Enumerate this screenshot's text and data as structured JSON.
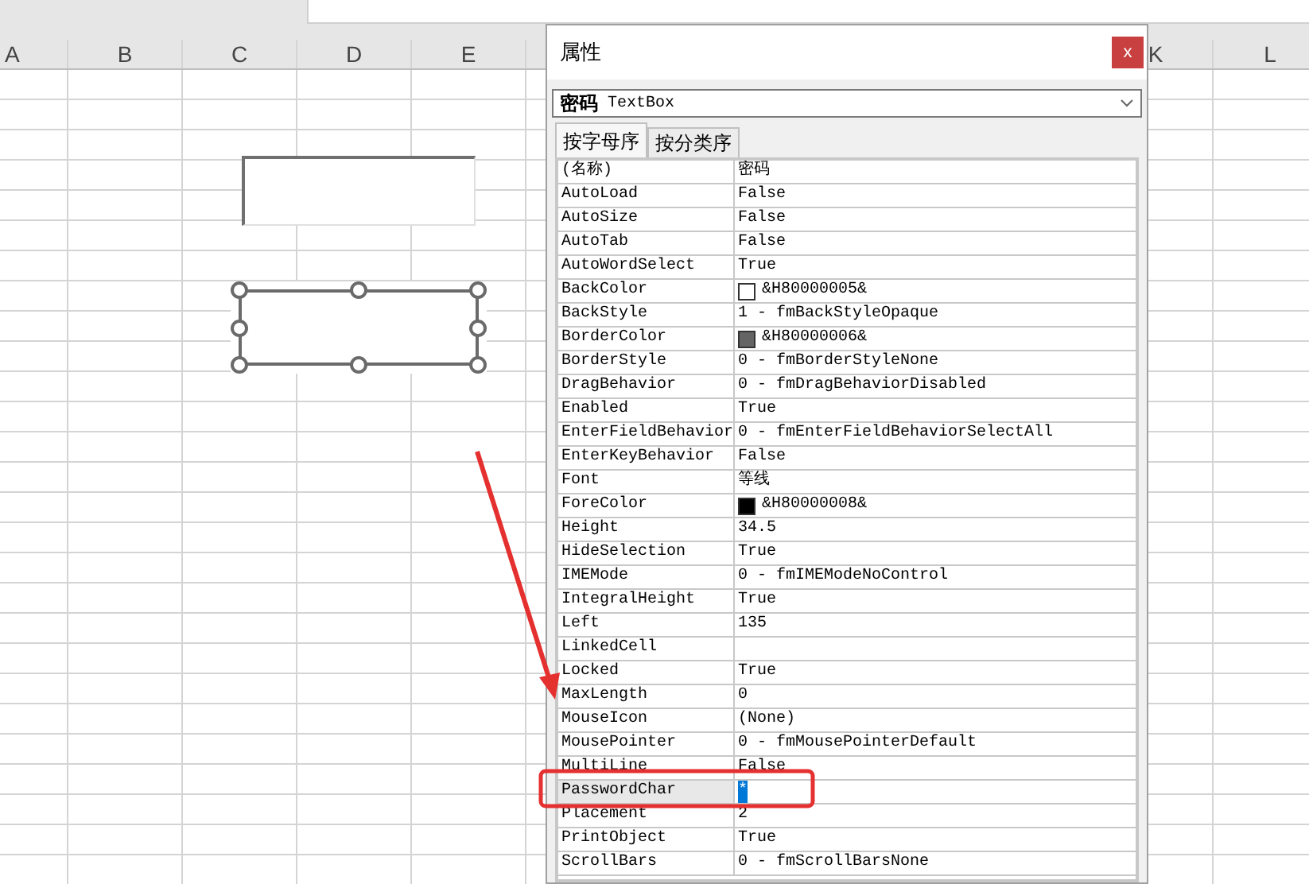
{
  "sheet": {
    "columns": [
      {
        "label": "A"
      },
      {
        "label": "B"
      },
      {
        "label": "C"
      },
      {
        "label": "D"
      },
      {
        "label": "E"
      }
    ],
    "right_columns": [
      {
        "label": "K"
      },
      {
        "label": "L"
      }
    ]
  },
  "properties_window": {
    "title": "属性",
    "close": "x",
    "object_selector": {
      "name": "密码",
      "type": "TextBox"
    },
    "tabs": [
      {
        "label": "按字母序",
        "selected": true
      },
      {
        "label": "按分类序",
        "selected": false
      }
    ],
    "rows": [
      {
        "name": "(名称)",
        "value": "密码",
        "selected": false
      },
      {
        "name": "AutoLoad",
        "value": "False",
        "selected": false
      },
      {
        "name": "AutoSize",
        "value": "False",
        "selected": false
      },
      {
        "name": "AutoTab",
        "value": "False",
        "selected": false
      },
      {
        "name": "AutoWordSelect",
        "value": "True",
        "selected": false
      },
      {
        "name": "BackColor",
        "value": "&H80000005&",
        "kind": "color",
        "color": "#ffffff",
        "selected": false
      },
      {
        "name": "BackStyle",
        "value": "1 - fmBackStyleOpaque",
        "selected": false
      },
      {
        "name": "BorderColor",
        "value": "&H80000006&",
        "kind": "color",
        "color": "#646464",
        "selected": false
      },
      {
        "name": "BorderStyle",
        "value": "0 - fmBorderStyleNone",
        "selected": false
      },
      {
        "name": "DragBehavior",
        "value": "0 - fmDragBehaviorDisabled",
        "selected": false
      },
      {
        "name": "Enabled",
        "value": "True",
        "selected": false
      },
      {
        "name": "EnterFieldBehavior",
        "value": "0 - fmEnterFieldBehaviorSelectAll",
        "selected": false
      },
      {
        "name": "EnterKeyBehavior",
        "value": "False",
        "selected": false
      },
      {
        "name": "Font",
        "value": "等线",
        "selected": false
      },
      {
        "name": "ForeColor",
        "value": "&H80000008&",
        "kind": "color",
        "color": "#000000",
        "selected": false
      },
      {
        "name": "Height",
        "value": "34.5",
        "selected": false
      },
      {
        "name": "HideSelection",
        "value": "True",
        "selected": false
      },
      {
        "name": "IMEMode",
        "value": "0 - fmIMEModeNoControl",
        "selected": false
      },
      {
        "name": "IntegralHeight",
        "value": "True",
        "selected": false
      },
      {
        "name": "Left",
        "value": "135",
        "selected": false
      },
      {
        "name": "LinkedCell",
        "selected": false
      },
      {
        "name": "Locked",
        "value": "True",
        "selected": false
      },
      {
        "name": "MaxLength",
        "value": "0",
        "selected": false
      },
      {
        "name": "MouseIcon",
        "value": "(None)",
        "selected": false
      },
      {
        "name": "MousePointer",
        "value": "0 - fmMousePointerDefault",
        "selected": false
      },
      {
        "name": "MultiLine",
        "value": "False",
        "selected": false
      },
      {
        "name": "PasswordChar",
        "value": "*",
        "selected": true
      },
      {
        "name": "Placement",
        "value": "2",
        "selected": false
      },
      {
        "name": "PrintObject",
        "value": "True",
        "selected": false
      },
      {
        "name": "ScrollBars",
        "value": "0 - fmScrollBarsNone",
        "selected": false
      }
    ]
  }
}
